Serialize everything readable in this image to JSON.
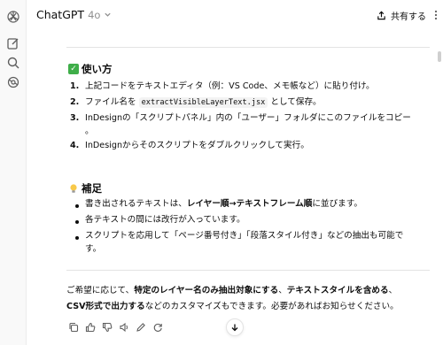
{
  "header": {
    "model": "ChatGPT",
    "version": "4o",
    "share_label": "共有する"
  },
  "usage": {
    "title": "使い方",
    "steps": [
      {
        "num": "1.",
        "text": "上記コードをテキストエディタ（例：VS Code、メモ帳など）に貼り付け。"
      },
      {
        "num": "2.",
        "pre": "ファイル名を ",
        "code": "extractVisibleLayerText.jsx",
        "post": " として保存。"
      },
      {
        "num": "3.",
        "line1": "InDesignの「スクリプトパネル」内の「ユーザー」フォルダにこのファイルをコピー",
        "line2": "。"
      },
      {
        "num": "4.",
        "text": "InDesignからそのスクリプトをダブルクリックして実行。"
      }
    ]
  },
  "notes": {
    "title": "補足",
    "bullets": [
      {
        "pre": "書き出されるテキストは、",
        "bold": "レイヤー順→テキストフレーム順",
        "post": "に並びます。"
      },
      {
        "text": "各テキストの間には改行が入っています。"
      },
      {
        "line1": "スクリプトを応用して「ページ番号付き」「段落スタイル付き」などの抽出も可能で",
        "line2": "す。"
      }
    ]
  },
  "closing": {
    "l1a": "ご希望に応じて、",
    "l1b": "特定のレイヤー名のみ抽出対象にする",
    "l1c": "、",
    "l1d": "テキストスタイルを含める",
    "l1e": "、",
    "l2a": "CSV形式で出力する",
    "l2b": "などのカスタマイズもできます。必要があればお知らせください。"
  },
  "icons": {
    "rail": [
      "openai-logo-icon",
      "new-chat-icon",
      "search-icon",
      "explore-gpts-icon"
    ],
    "actions": [
      "copy-icon",
      "thumbs-up-icon",
      "thumbs-down-icon",
      "read-aloud-icon",
      "edit-icon",
      "regenerate-icon"
    ]
  }
}
